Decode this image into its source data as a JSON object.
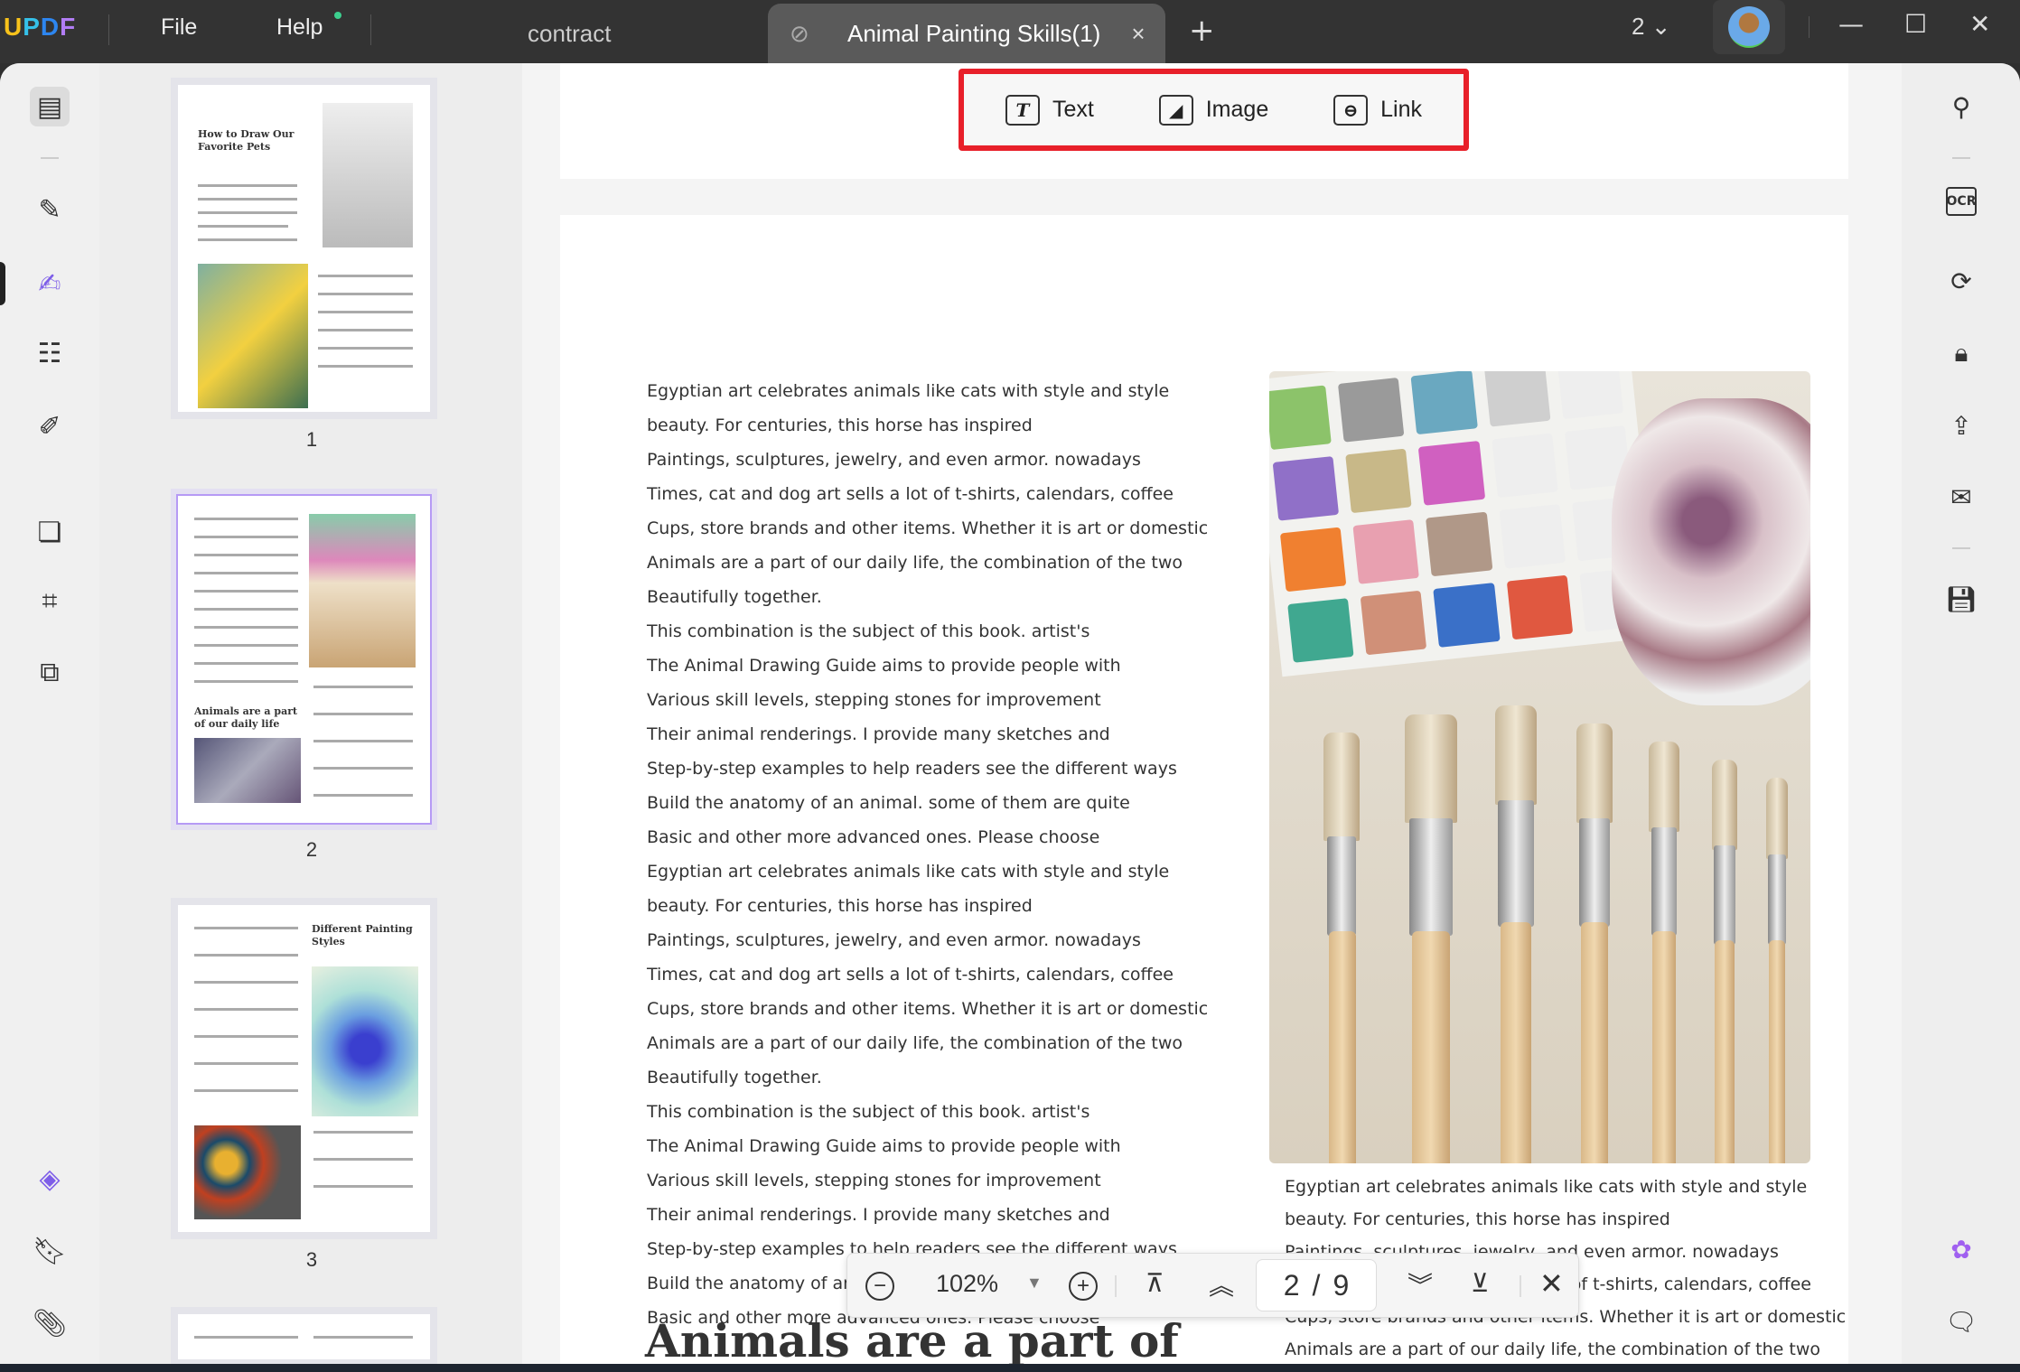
{
  "app": {
    "logo": [
      "U",
      "P",
      "D",
      "F"
    ],
    "menu": {
      "file": "File",
      "help": "Help"
    }
  },
  "tabs": [
    {
      "label": "contract"
    },
    {
      "label": "Animal Painting Skills(1)",
      "close": "×"
    }
  ],
  "new_tab": "+",
  "window": {
    "page_select": "2",
    "minimize": "—",
    "maximize": "☐",
    "close": "✕"
  },
  "edit_toolbar": {
    "text": "Text",
    "image": "Image",
    "link": "Link"
  },
  "thumbnails": [
    {
      "num": "1",
      "title": "How to Draw Our Favorite Pets"
    },
    {
      "num": "2",
      "title": "Animals are a part of our daily life"
    },
    {
      "num": "3",
      "title": "Different Painting Styles"
    }
  ],
  "page": {
    "column1": [
      "Egyptian art celebrates animals like cats with style and style",
      "beauty. For centuries, this horse has inspired",
      "Paintings, sculptures, jewelry, and even armor. nowadays",
      "Times, cat and dog art sells a lot of t-shirts, calendars, coffee",
      "Cups, store brands and other items. Whether it is art or domestic",
      "Animals are a part of our daily life, the combination of the two",
      "Beautifully together.",
      "This combination is the subject of this book. artist's",
      "The Animal Drawing Guide aims to provide people with",
      "Various skill levels, stepping stones for improvement",
      "Their animal renderings. I provide many sketches and",
      "Step-by-step examples to help readers see the different ways",
      "Build the anatomy of an animal. some of them are quite",
      "Basic and other more advanced ones. Please choose",
      "Egyptian art celebrates animals like cats with style and style",
      "beauty. For centuries, this horse has inspired",
      "Paintings, sculptures, jewelry, and even armor. nowadays",
      "Times, cat and dog art sells a lot of t-shirts, calendars, coffee",
      "Cups, store brands and other items. Whether it is art or domestic",
      "Animals are a part of our daily life, the combination of the two",
      "Beautifully together.",
      "This combination is the subject of this book. artist's",
      "The Animal Drawing Guide aims to provide people with",
      "Various skill levels, stepping stones for improvement",
      "Their animal renderings. I provide many sketches and",
      "Step-by-step examples to help readers see the different ways",
      "Build the anatomy of an animal. some of them are quite",
      "Basic and other more advanced ones. Please choose"
    ],
    "column2": [
      "Egyptian art celebrates animals like cats with style and style",
      "beauty. For centuries, this horse has inspired",
      "Paintings, sculptures, jewelry, and even armor. nowadays",
      "Times, cat and dog art sells a lot of t-shirts, calendars, coffee",
      "Cups, store brands and other items. Whether it is art or domestic",
      "Animals are a part of our daily life, the combination of the two"
    ],
    "heading": "Animals are a part of"
  },
  "navbar": {
    "zoom": "102%",
    "current_page": "2",
    "separator": "/",
    "total_pages": "9"
  },
  "colors": {
    "accent": "#7e5ee8",
    "highlight_box": "#e8202a"
  }
}
